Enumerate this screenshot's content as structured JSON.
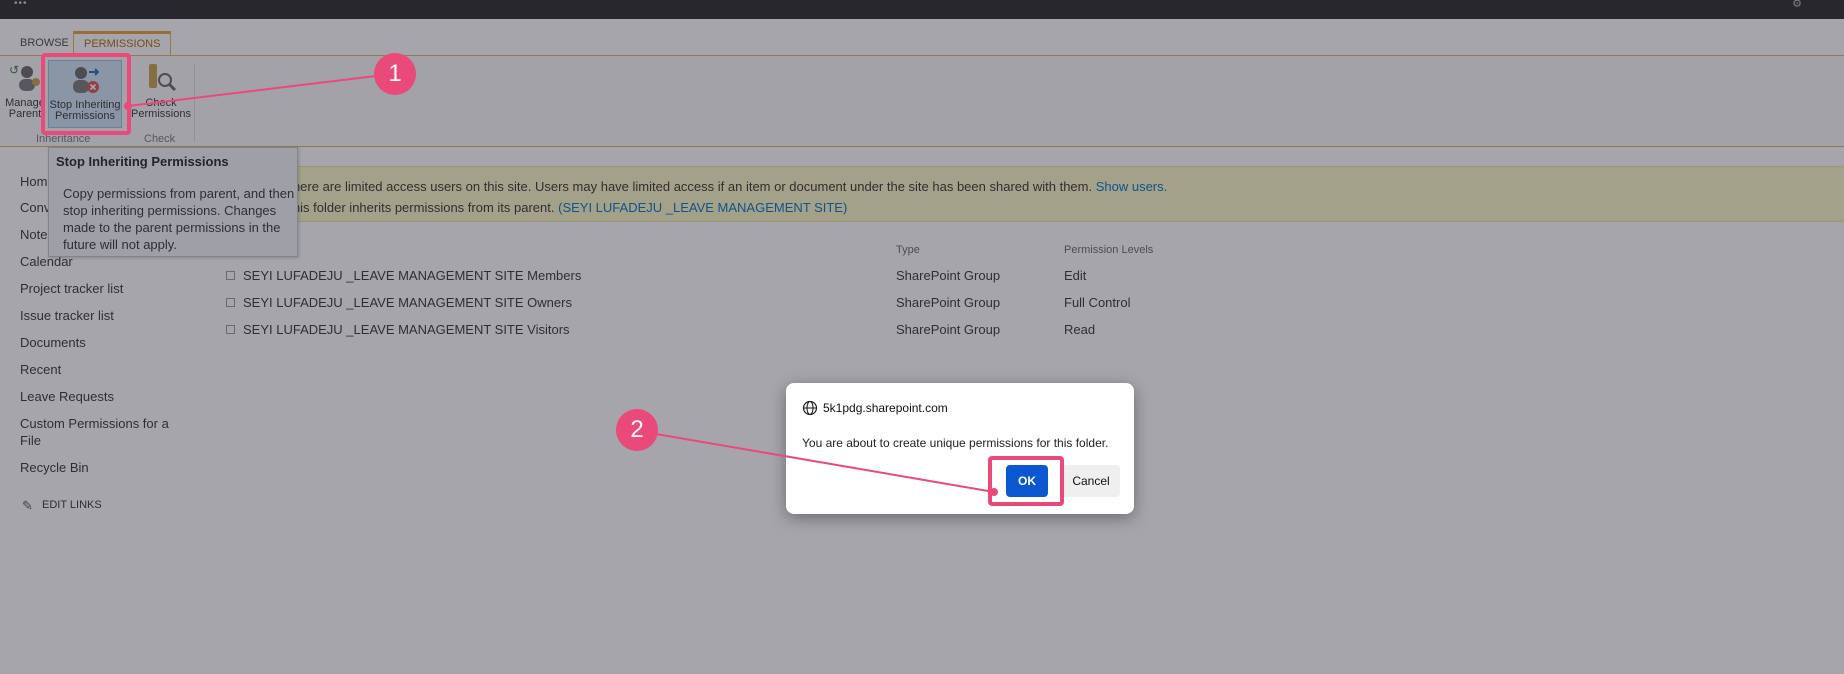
{
  "tabs": {
    "browse": "BROWSE",
    "permissions": "PERMISSIONS"
  },
  "ribbon": {
    "manage_parent": "Manage Parent",
    "stop_inheriting": "Stop Inheriting Permissions",
    "check_permissions": "Check Permissions",
    "group_inheritance": "Inheritance",
    "group_check": "Check"
  },
  "tooltip": {
    "title": "Stop Inheriting Permissions",
    "body": "Copy permissions from parent, and then stop inheriting permissions. Changes made to the parent permissions in the future will not apply."
  },
  "nav": {
    "items": [
      "Home",
      "Conversations",
      "Notebook",
      "Calendar",
      "Project tracker list",
      "Issue tracker list",
      "Documents",
      "Recent",
      "Leave Requests",
      "Custom Permissions for a",
      "File",
      "Recycle Bin"
    ],
    "edit_links": "EDIT LINKS"
  },
  "notice": {
    "line1": "There are limited access users on this site. Users may have limited access if an item or document under the site has been shared with them.",
    "line1_link": "Show users.",
    "line2": "This folder inherits permissions from its parent.",
    "line2_link": "(SEYI LUFADEJU _LEAVE MANAGEMENT SITE)"
  },
  "table": {
    "col_type": "Type",
    "col_level": "Permission Levels",
    "rows": [
      {
        "name": "SEYI LUFADEJU _LEAVE MANAGEMENT SITE Members",
        "type": "SharePoint Group",
        "level": "Edit"
      },
      {
        "name": "SEYI LUFADEJU _LEAVE MANAGEMENT SITE Owners",
        "type": "SharePoint Group",
        "level": "Full Control"
      },
      {
        "name": "SEYI LUFADEJU _LEAVE MANAGEMENT SITE Visitors",
        "type": "SharePoint Group",
        "level": "Read"
      }
    ]
  },
  "dialog": {
    "origin": "5k1pdg.sharepoint.com",
    "message": "You are about to create unique permissions for this folder.",
    "ok": "OK",
    "cancel": "Cancel"
  },
  "annotations": {
    "step1": "1",
    "step2": "2"
  },
  "colors": {
    "accent": "#e94a7a",
    "ribbon_border": "#e8b35a",
    "link": "#0072c6",
    "ok_button": "#0b57d0",
    "notice_bg": "#fcf8c6"
  }
}
